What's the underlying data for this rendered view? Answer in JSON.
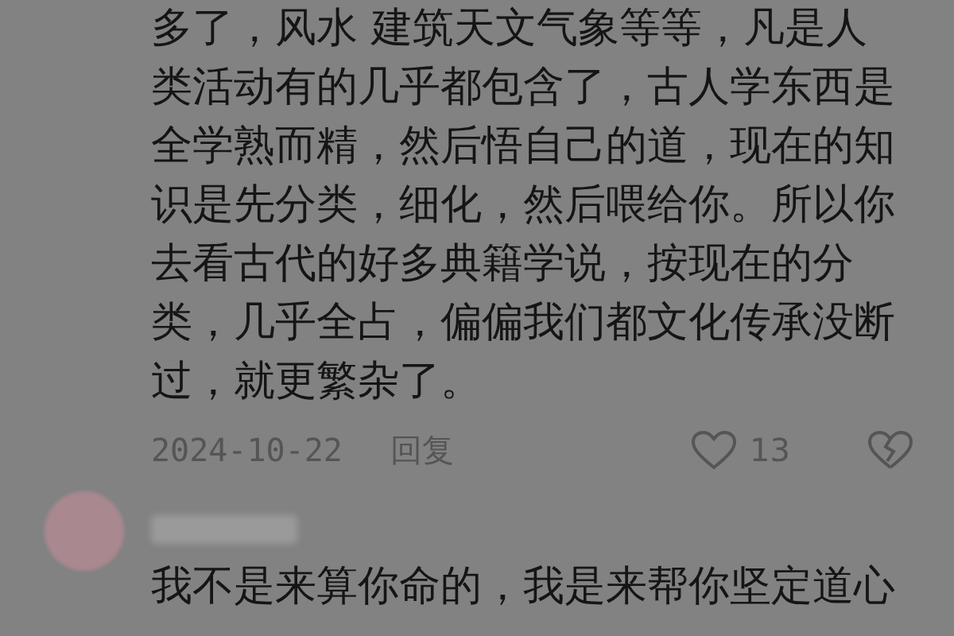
{
  "comments": [
    {
      "text_lines": [
        "多了，风水 建筑天文气象等等，凡是人",
        "类活动有的几乎都包含了，古人学东西是",
        "全学熟而精，然后悟自己的道，现在的知",
        "识是先分类，细化，然后喂给你。所以你",
        "去看古代的好多典籍学说，按现在的分",
        "类，几乎全占，偏偏我们都文化传承没断",
        "过，就更繁杂了。"
      ],
      "date": "2024-10-22",
      "reply": "回复",
      "likes": "13"
    },
    {
      "text_lines": [
        "我不是来算你命的，我是来帮你坚定道心"
      ]
    }
  ]
}
